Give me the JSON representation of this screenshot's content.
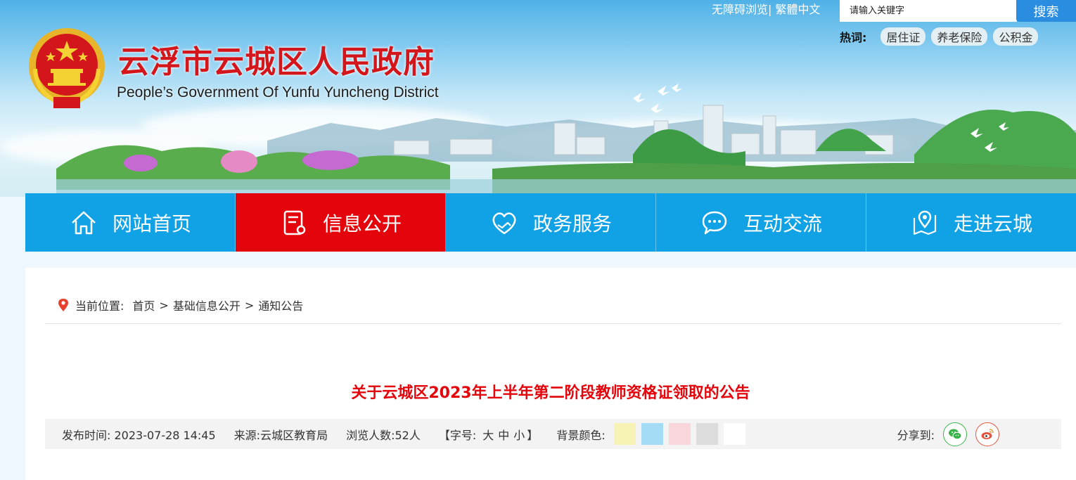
{
  "header": {
    "title": "云浮市云城区人民政府",
    "subtitle": "People’s Government Of Yunfu Yuncheng District",
    "accessible_link": "无障碍浏览",
    "separator": "|",
    "traditional_link": "繁體中文",
    "search": {
      "placeholder": "请输入关键字",
      "button": "搜索"
    },
    "hot": {
      "label": "热词:",
      "tags": [
        "居住证",
        "养老保险",
        "公积金"
      ]
    }
  },
  "nav": {
    "items": [
      {
        "label": "网站首页",
        "icon": "home-icon"
      },
      {
        "label": "信息公开",
        "icon": "document-icon",
        "active": true
      },
      {
        "label": "政务服务",
        "icon": "handshake-heart-icon"
      },
      {
        "label": "互动交流",
        "icon": "chat-bubble-icon"
      },
      {
        "label": "走进云城",
        "icon": "map-pin-icon"
      }
    ]
  },
  "breadcrumb": {
    "label": "当前位置:",
    "items": [
      "首页",
      "基础信息公开",
      "通知公告"
    ],
    "separator": ">"
  },
  "article": {
    "title": "关于云城区2023年上半年第二阶段教师资格证领取的公告",
    "meta": {
      "publish": "发布时间:  2023-07-28 14:45",
      "source": "来源:云城区教育局",
      "views": "浏览人数:52人",
      "font_size_prefix": "【字号:",
      "font_large": "大",
      "font_medium": "中",
      "font_small": "小",
      "font_size_suffix": "】",
      "bg_label": "背景颜色:",
      "bg_colors": [
        "#f7f3b6",
        "#a3dcf4",
        "#f9d5dc",
        "#dcdcdc",
        "#ffffff"
      ],
      "share_label": "分享到:"
    }
  },
  "colors": {
    "accent_red": "#e3050b",
    "nav_blue": "#11a2e6",
    "wechat": "#3cb34a",
    "weibo": "#e2533b"
  }
}
